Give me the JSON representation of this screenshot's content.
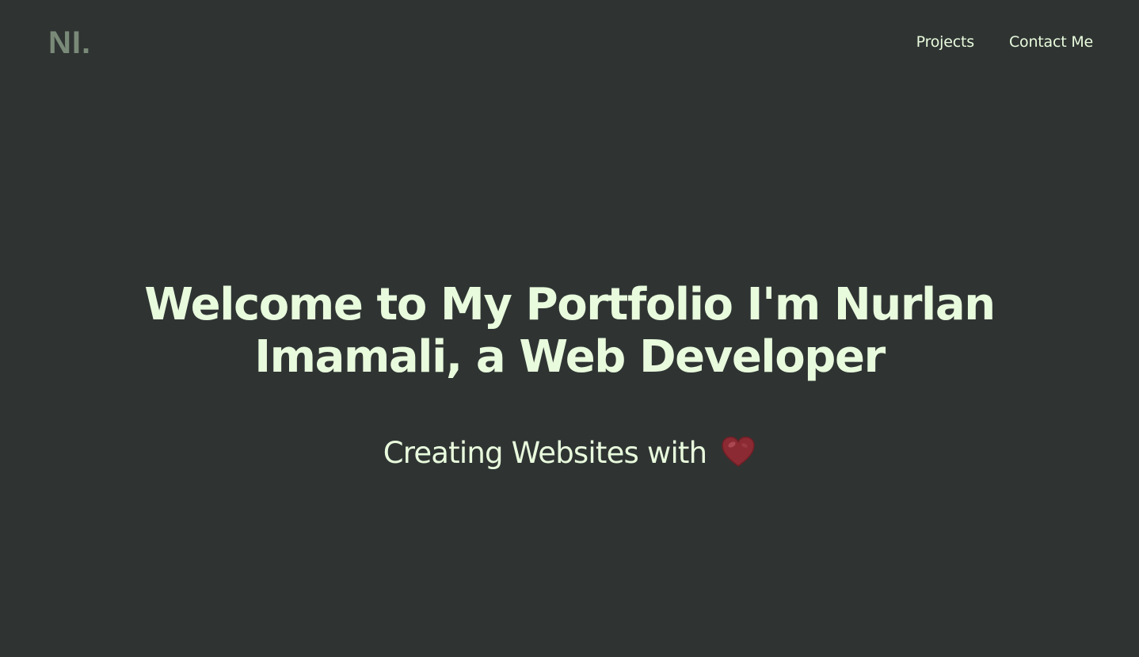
{
  "header": {
    "logo": "NI.",
    "nav": [
      {
        "label": "Projects"
      },
      {
        "label": "Contact Me"
      }
    ]
  },
  "hero": {
    "title": "Welcome to My Portfolio I'm Nurlan Imamali, a Web Developer",
    "tagline": "Creating Websites with",
    "tagline_icon": "heart-icon"
  },
  "colors": {
    "background": "#2f3433",
    "text": "#e9fbdd",
    "logo": "#7a8a78",
    "heart": "#8b2a32"
  }
}
